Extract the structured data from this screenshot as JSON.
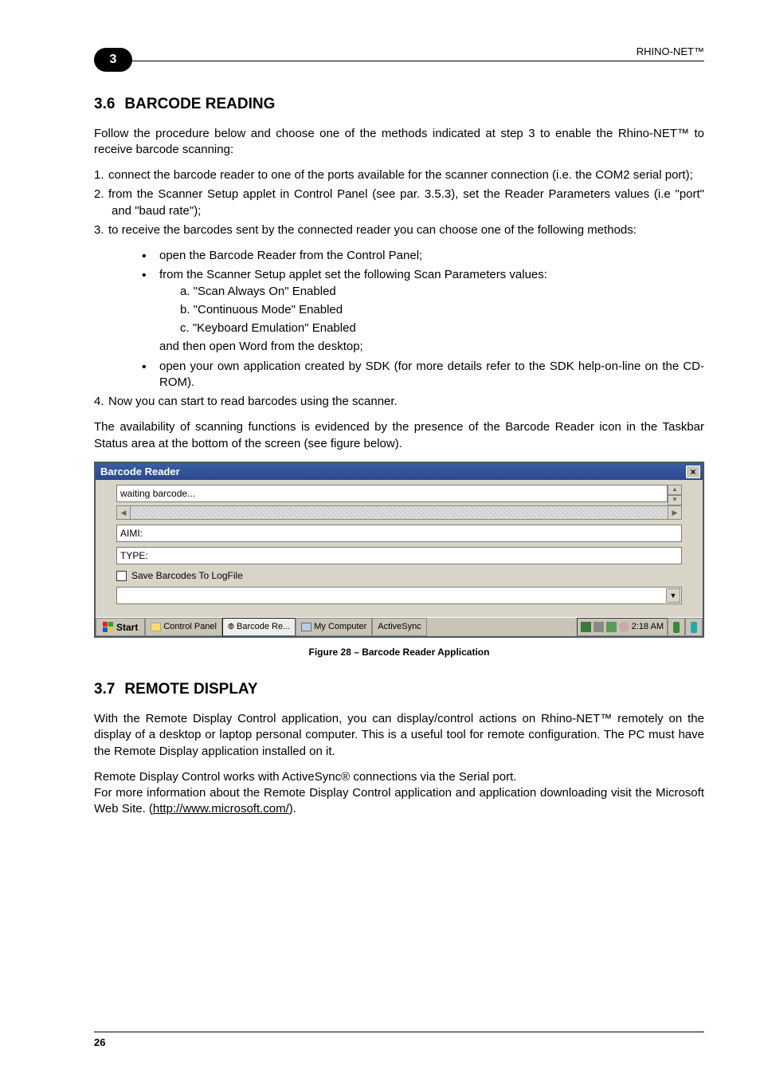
{
  "header": {
    "product": "RHINO-NET™",
    "chapter": "3"
  },
  "section36": {
    "number": "3.6",
    "title": "BARCODE READING",
    "intro": "Follow the procedure below and choose one of the methods indicated at step 3 to enable the Rhino-NET™ to receive barcode scanning:",
    "steps": {
      "s1": "connect the barcode reader to one of the ports available for the scanner connection (i.e. the COM2 serial port);",
      "s2": "from the Scanner Setup applet in Control Panel (see par. 3.5.3), set the Reader Parameters values (i.e \"port\" and \"baud rate\");",
      "s3_lead": "to receive the barcodes sent by the connected reader you can choose one of the following methods:",
      "s3_b1": "open the Barcode Reader from the Control Panel;",
      "s3_b2_lead": "from the Scanner Setup applet set the following Scan Parameters values:",
      "s3_b2_a": "a.  \"Scan Always On\"     Enabled",
      "s3_b2_b": "b.  \"Continuous Mode\"     Enabled",
      "s3_b2_c": "c.  \"Keyboard Emulation\"     Enabled",
      "s3_b2_tail": "and then open Word from the desktop;",
      "s3_b3": "open your own application created by SDK (for more details refer to the SDK help-on-line on the CD-ROM).",
      "s4": "Now you can start to read barcodes using the scanner."
    },
    "para2": "The availability of scanning functions is evidenced by the presence of the Barcode Reader icon in the Taskbar Status area at the bottom of the screen (see figure below)."
  },
  "window": {
    "title": "Barcode Reader",
    "waiting": "waiting barcode...",
    "aimi": "AIMI:",
    "type": "TYPE:",
    "save": "Save Barcodes To LogFile"
  },
  "taskbar": {
    "start": "Start",
    "t1": "Control Panel",
    "t2": "Barcode Re...",
    "t3": "My Computer",
    "t4": "ActiveSync",
    "clock": "2:18 AM"
  },
  "caption": "Figure 28 – Barcode Reader Application",
  "section37": {
    "number": "3.7",
    "title": "REMOTE DISPLAY",
    "p1": "With the Remote Display Control application, you can display/control actions on Rhino-NET™ remotely on the display of a desktop or laptop personal computer. This is a useful tool for remote configuration. The PC must have the Remote Display application installed on it.",
    "p2": "Remote Display Control works with ActiveSync® connections via the Serial port.",
    "p3_pre": "For more information about the Remote Display Control application and application downloading visit the Microsoft Web Site. (",
    "url": "http://www.microsoft.com/",
    "p3_post": ")."
  },
  "footer": {
    "page": "26"
  }
}
